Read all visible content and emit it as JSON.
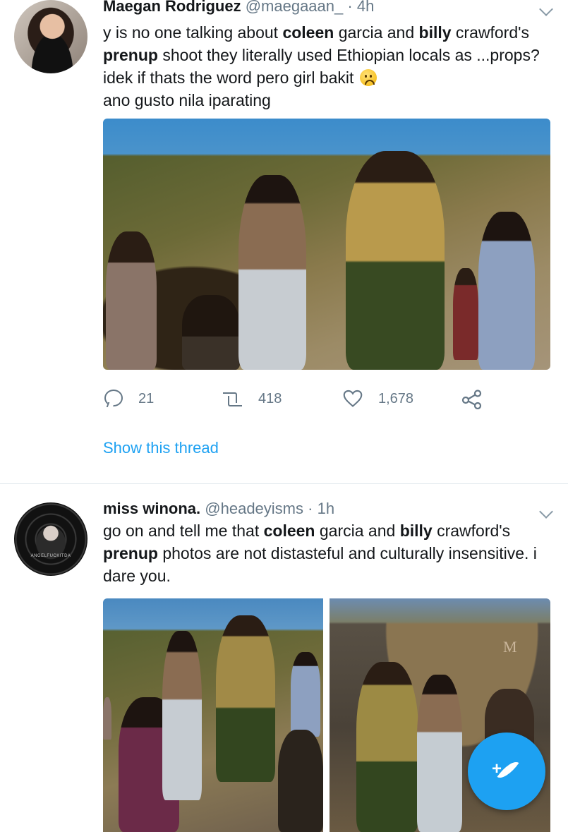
{
  "tweets": [
    {
      "name": "Maegan Rodriguez",
      "handle": "@maegaaan_",
      "separator": "·",
      "time": "4h",
      "text": {
        "p1": "y is no one talking about ",
        "b1": "coleen",
        "p2": " garcia and ",
        "b2": "billy",
        "p3": " crawford's ",
        "b3": "prenup",
        "p4": " shoot they literally used Ethiopian locals as ...props? idek if thats the word pero girl bakit ",
        "p5": " ano gusto nila iparating"
      },
      "emoji": "worried-face",
      "actions": {
        "replies": "21",
        "retweets": "418",
        "likes": "1,678"
      },
      "show_thread": "Show this thread"
    },
    {
      "name": "miss winona.",
      "handle": "@headeyisms",
      "separator": "·",
      "time": "1h",
      "text": {
        "p1": "go on and tell me that ",
        "b1": "coleen",
        "p2": " garcia and ",
        "b2": "billy",
        "p3": " crawford's ",
        "b3": "prenup",
        "p4": " photos are not distasteful and culturally insensitive. i dare you."
      },
      "avatar_caption": "ANGELFUCKITDA"
    }
  ],
  "photo_watermark": "M",
  "fab": {
    "plus": "+",
    "icon": "compose-feather-icon"
  },
  "colors": {
    "accent": "#1da1f2",
    "secondary_text": "#657786",
    "divider": "#e1e8ed"
  },
  "icons": [
    "reply-icon",
    "retweet-icon",
    "heart-icon",
    "share-icon",
    "chevron-down-icon"
  ]
}
